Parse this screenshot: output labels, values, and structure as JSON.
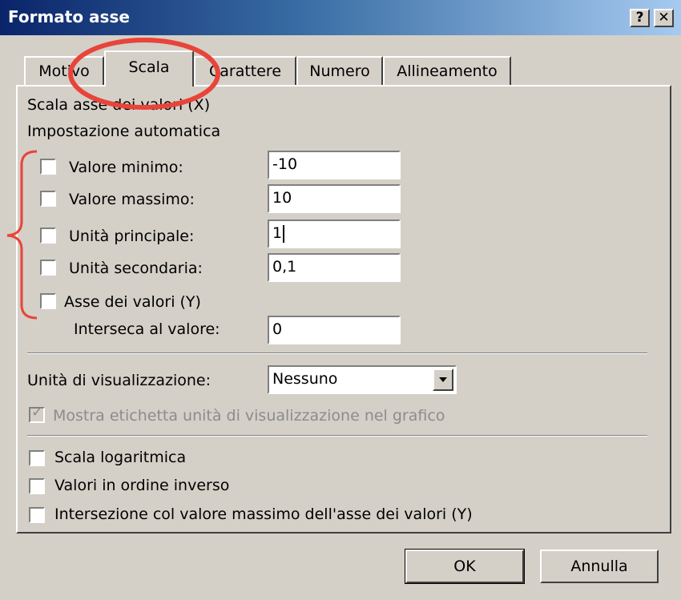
{
  "window": {
    "title": "Formato asse",
    "help_label": "?",
    "close_label": "✕"
  },
  "tabs": [
    {
      "label": "Motivo"
    },
    {
      "label": "Scala"
    },
    {
      "label": "Carattere"
    },
    {
      "label": "Numero"
    },
    {
      "label": "Allineamento"
    }
  ],
  "active_tab": "Scala",
  "section": {
    "heading": "Scala asse dei valori (X)",
    "subheading": "Impostazione automatica"
  },
  "auto_settings": [
    {
      "label": "Valore minimo:",
      "value": "-10",
      "checked": false
    },
    {
      "label": "Valore massimo:",
      "value": "10",
      "checked": false
    },
    {
      "label": "Unità principale:",
      "value": "1",
      "checked": false
    },
    {
      "label": "Unità secondaria:",
      "value": "0,1",
      "checked": false
    },
    {
      "label": "Asse dei valori (Y)",
      "checked": false
    }
  ],
  "intersect": {
    "label": "Interseca al valore:",
    "value": "0"
  },
  "display_units": {
    "label": "Unità di visualizzazione:",
    "selected": "Nessuno"
  },
  "show_label": {
    "label": "Mostra etichetta unità di visualizzazione nel grafico",
    "checked": true,
    "disabled": true
  },
  "options": [
    {
      "label": "Scala logaritmica",
      "checked": false
    },
    {
      "label": "Valori in ordine inverso",
      "checked": false
    },
    {
      "label": "Intersezione col valore massimo dell'asse dei valori (Y)",
      "checked": false
    }
  ],
  "buttons": {
    "ok": "OK",
    "cancel": "Annulla"
  },
  "annotation_color": "#e8443a"
}
